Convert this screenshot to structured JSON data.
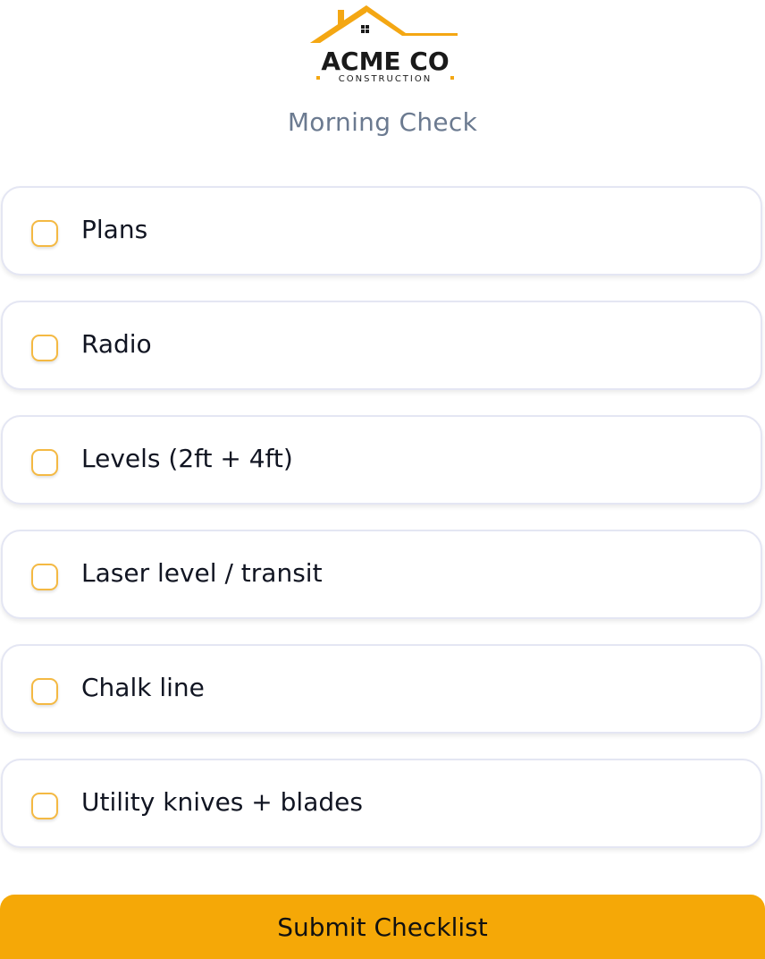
{
  "logo": {
    "name": "ACME CO",
    "tagline": "CONSTRUCTION"
  },
  "header": {
    "subtitle": "Morning Check"
  },
  "checklist": {
    "items": [
      {
        "label": "Plans",
        "checked": false
      },
      {
        "label": "Radio",
        "checked": false
      },
      {
        "label": "Levels (2ft + 4ft)",
        "checked": false
      },
      {
        "label": "Laser level / transit",
        "checked": false
      },
      {
        "label": "Chalk line",
        "checked": false
      },
      {
        "label": "Utility knives + blades",
        "checked": false
      }
    ]
  },
  "submit": {
    "label": "Submit Checklist"
  },
  "colors": {
    "accent": "#f5a807",
    "checkbox_border": "#f4b943",
    "card_border": "#e4e6f3",
    "subtitle_text": "#6b7a90",
    "logo_text": "#1a1a1a"
  }
}
